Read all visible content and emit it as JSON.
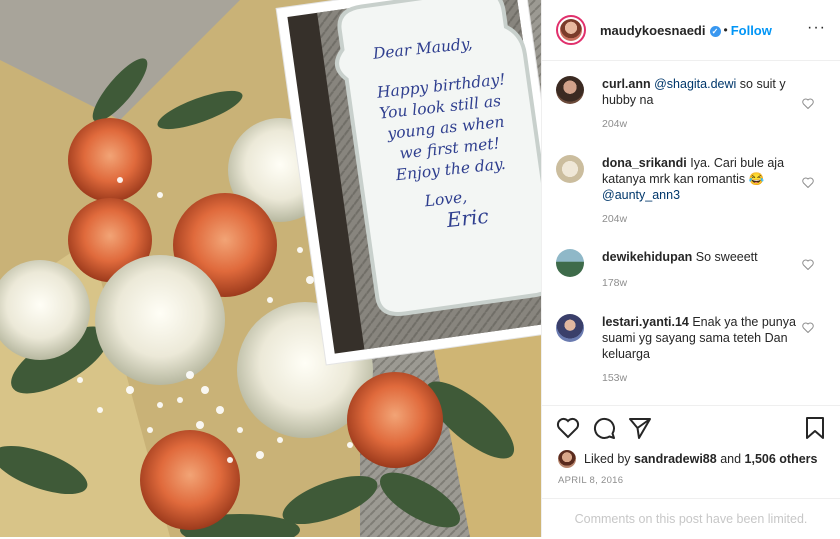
{
  "post": {
    "username": "maudykoesnaedi",
    "verified_mark": "✓",
    "separator": "•",
    "follow_label": "Follow",
    "more_label": "···"
  },
  "note": {
    "lines": [
      "Dear Maudy,",
      "Happy birthday!",
      "You look still as",
      "young as when",
      "we first met!",
      "Enjoy the day.",
      "Love,"
    ],
    "signature": "Eric"
  },
  "comments": [
    {
      "user": "curl.ann",
      "mention": "@shagita.dewi",
      "text": " so suit y hubby na",
      "time": "204w"
    },
    {
      "user": "dona_srikandi",
      "text": "Iya. Cari bule aja katanya mrk kan romantis 😂 ",
      "mention": "@aunty_ann3",
      "time": "204w"
    },
    {
      "user": "dewikehidupan",
      "text": "So sweeett",
      "time": "178w"
    },
    {
      "user": "lestari.yanti.14",
      "text": "Enak ya the punya suami yg sayang sama teteh Dan keluarga",
      "time": "153w"
    }
  ],
  "actions": {
    "liked_by_prefix": "Liked by ",
    "liked_by_user": "sandradewi88",
    "liked_and": " and ",
    "others": "1,506 others",
    "date": "APRIL 8, 2016",
    "comments_limited": "Comments on this post have been limited."
  },
  "colors": {
    "accent": "#0095f6",
    "muted": "#8e8e8e",
    "mention": "#00376b"
  },
  "icons": [
    "heart-icon",
    "comment-icon",
    "share-icon",
    "save-icon",
    "more-icon",
    "verified-icon"
  ]
}
